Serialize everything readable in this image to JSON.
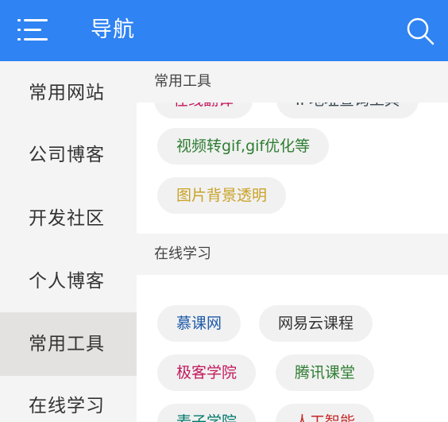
{
  "app": {
    "title": "导航",
    "accent": "#2f83f2"
  },
  "icons": {
    "menu": "menu-icon",
    "search": "search-icon"
  },
  "sidebar": {
    "active_index": 4,
    "items": [
      {
        "label": "常用网站"
      },
      {
        "label": "公司博客"
      },
      {
        "label": "开发社区"
      },
      {
        "label": "个人博客"
      },
      {
        "label": "常用工具"
      },
      {
        "label": "在线学习"
      }
    ]
  },
  "sections": [
    {
      "title": "常用工具",
      "chips": [
        {
          "label": "在线翻译",
          "color": "#c2185b"
        },
        {
          "label": "IP地址查询工具",
          "color": "#37474f"
        },
        {
          "label": "视频转gif,gif优化等",
          "color": "#2e7d32"
        },
        {
          "label": "图片背景透明",
          "color": "#c9a227"
        }
      ]
    },
    {
      "title": "在线学习",
      "chips": [
        {
          "label": "慕课网",
          "color": "#1e5aa8"
        },
        {
          "label": "网易云课程",
          "color": "#333333"
        },
        {
          "label": "极客学院",
          "color": "#c2185b"
        },
        {
          "label": "腾讯课堂",
          "color": "#2e7d32"
        },
        {
          "label": "麦子学院",
          "color": "#00796b"
        },
        {
          "label": "人工智能",
          "color": "#c62828"
        }
      ]
    }
  ]
}
